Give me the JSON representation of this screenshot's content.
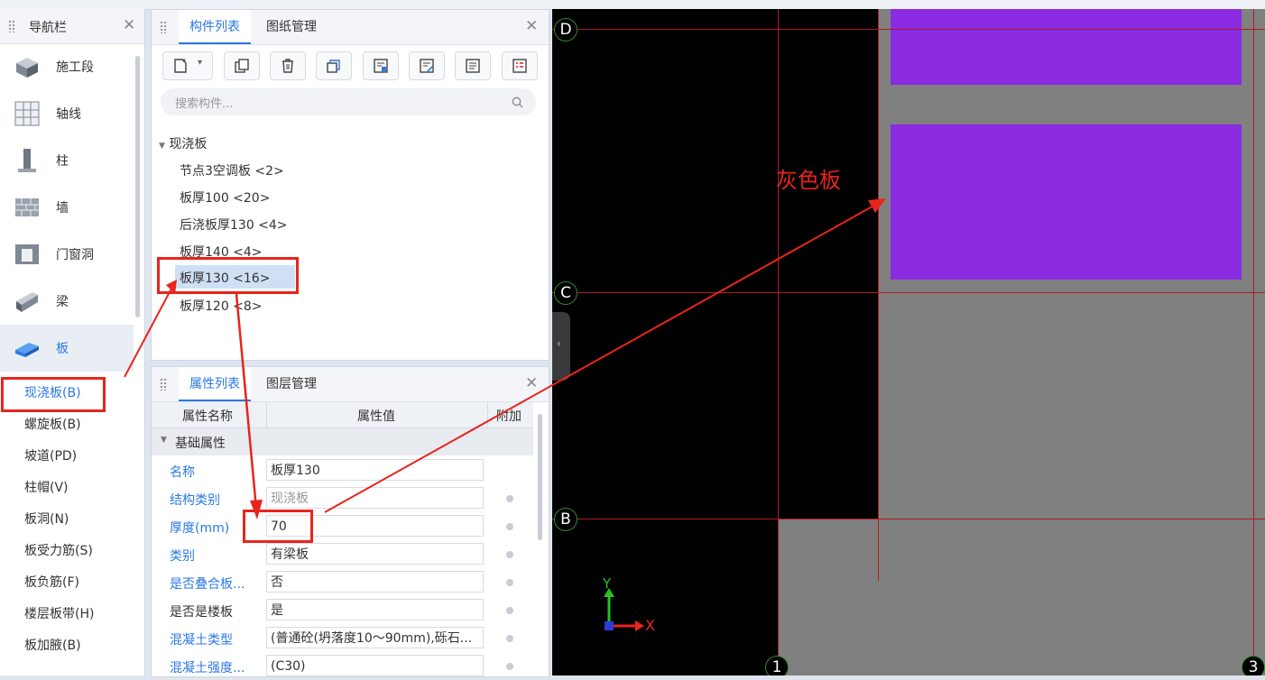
{
  "nav_panel": {
    "title": "导航栏",
    "items": [
      {
        "label": "施工段",
        "icon": "construction-segment-icon"
      },
      {
        "label": "轴线",
        "icon": "grid-axis-icon"
      },
      {
        "label": "柱",
        "icon": "column-icon"
      },
      {
        "label": "墙",
        "icon": "wall-icon"
      },
      {
        "label": "门窗洞",
        "icon": "door-window-icon"
      },
      {
        "label": "梁",
        "icon": "beam-icon"
      },
      {
        "label": "板",
        "icon": "slab-icon"
      }
    ],
    "sub_items": [
      "现浇板(B)",
      "螺旋板(B)",
      "坡道(PD)",
      "柱帽(V)",
      "板洞(N)",
      "板受力筋(S)",
      "板负筋(F)",
      "楼层板带(H)",
      "板加腋(B)"
    ]
  },
  "component_panel": {
    "tabs": [
      "构件列表",
      "图纸管理"
    ],
    "search_placeholder": "搜索构件...",
    "tree_root": "现浇板",
    "tree_items": [
      "节点3空调板 <2>",
      "板厚100 <20>",
      "后浇板厚130 <4>",
      "板厚140 <4>",
      "板厚130 <16>",
      "板厚120 <8>"
    ],
    "selected_index": 4
  },
  "property_panel": {
    "tabs": [
      "属性列表",
      "图层管理"
    ],
    "columns": [
      "属性名称",
      "属性值",
      "附加"
    ],
    "group": "基础属性",
    "rows": [
      {
        "name": "名称",
        "value": "板厚130",
        "blue": true
      },
      {
        "name": "结构类别",
        "value": "现浇板",
        "blue": true,
        "dim": true
      },
      {
        "name": "厚度(mm)",
        "value": "70",
        "blue": true
      },
      {
        "name": "类别",
        "value": "有梁板",
        "blue": true
      },
      {
        "name": "是否叠合板...",
        "value": "否",
        "blue": true
      },
      {
        "name": "是否是楼板",
        "value": "是",
        "blue": false
      },
      {
        "name": "混凝土类型",
        "value": "(普通砼(坍落度10～90mm),砾石...",
        "blue": true
      },
      {
        "name": "混凝土强度...",
        "value": "(C30)",
        "blue": true
      }
    ]
  },
  "canvas": {
    "axis_labels": [
      "D",
      "C",
      "B",
      "1",
      "3"
    ],
    "annotation": "灰色板",
    "coord_x": "X",
    "coord_y": "Y",
    "colors": {
      "slab_purple": "#8a2be2",
      "slab_gray": "#808080",
      "grid_red": "#b01c1c",
      "annot_red": "#e8241c"
    }
  }
}
